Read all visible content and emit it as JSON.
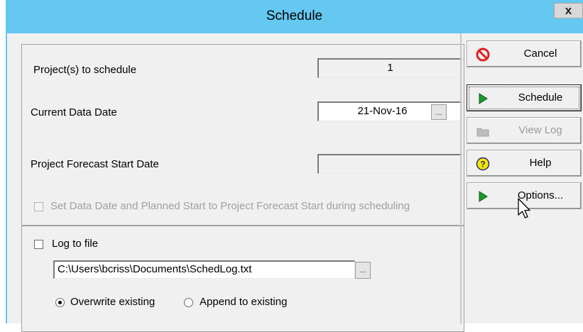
{
  "window": {
    "title": "Schedule",
    "close_label": "x"
  },
  "fields": {
    "projects_label": "Project(s) to schedule",
    "projects_value": "1",
    "data_date_label": "Current Data Date",
    "data_date_value": "21-Nov-16",
    "data_date_browse": "...",
    "forecast_label": "Project Forecast Start Date",
    "forecast_value": "",
    "set_data_date_label": "Set Data Date and Planned Start to Project Forecast Start during scheduling",
    "set_data_date_checked": false,
    "set_data_date_enabled": false
  },
  "log": {
    "log_to_file_label": "Log to file",
    "log_to_file_checked": false,
    "path_value": "C:\\Users\\bcriss\\Documents\\SchedLog.txt",
    "path_browse": "...",
    "overwrite_label": "Overwrite existing",
    "append_label": "Append to existing",
    "selected_mode": "overwrite"
  },
  "buttons": {
    "cancel": "Cancel",
    "schedule": "Schedule",
    "view_log": "View Log",
    "help": "Help",
    "options": "Options..."
  },
  "icons": {
    "cancel": "no-entry-icon",
    "schedule": "play-icon",
    "view_log": "folder-icon",
    "help": "question-icon",
    "options": "play-icon"
  },
  "colors": {
    "title_bar": "#64c8f0",
    "cancel_red": "#e02020",
    "play_green": "#1a9a2a",
    "help_yellow": "#f2e600"
  }
}
